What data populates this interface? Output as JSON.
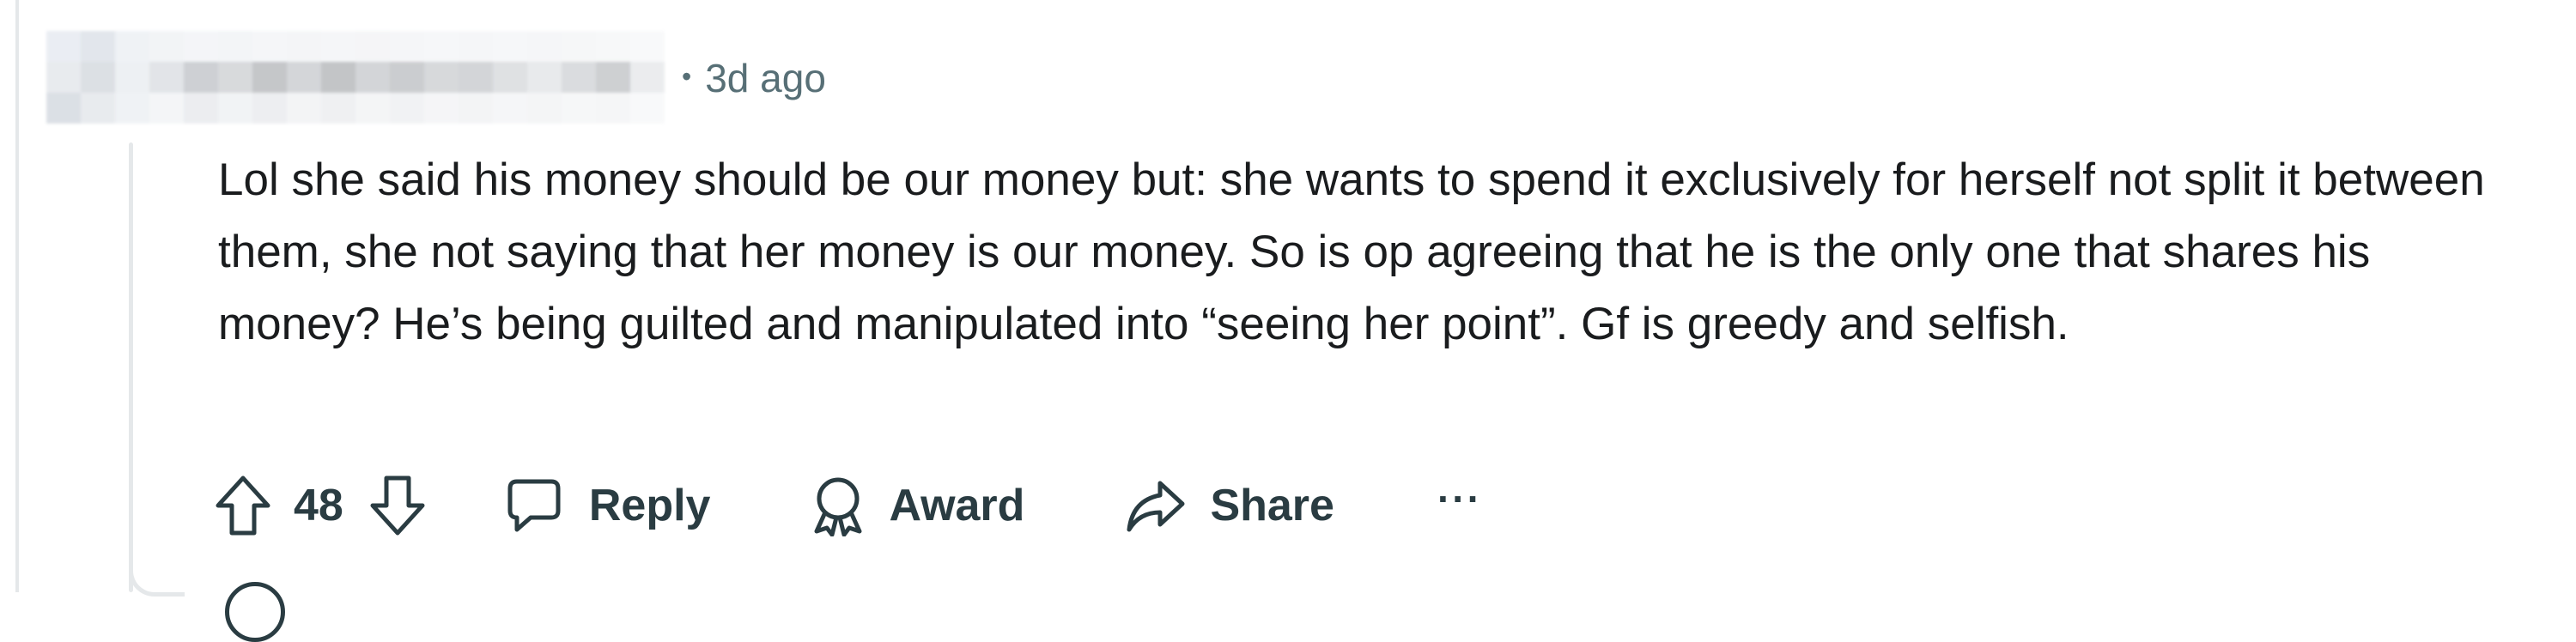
{
  "comment": {
    "author_blurred": "",
    "separator": "•",
    "time_ago": "3d ago",
    "body": "Lol she said his money should be our money but: she wants to spend it exclusively for herself not split it between them, she not saying that her money is our money. So is op agreeing that he is the only one that shares his money? He’s being guilted and manipulated into “seeing her point”. Gf is greedy and selfish."
  },
  "actions": {
    "upvote_icon": "arrow-up-icon",
    "vote_count": "48",
    "downvote_icon": "arrow-down-icon",
    "reply_icon": "speech-bubble-icon",
    "reply_label": "Reply",
    "award_icon": "award-ribbon-icon",
    "award_label": "Award",
    "share_icon": "share-arrow-icon",
    "share_label": "Share",
    "more_label": "···"
  },
  "colors": {
    "text": "#1a1c1e",
    "meta": "#576f76",
    "action": "#2a3c42",
    "thread_line": "#e5e8ea"
  }
}
